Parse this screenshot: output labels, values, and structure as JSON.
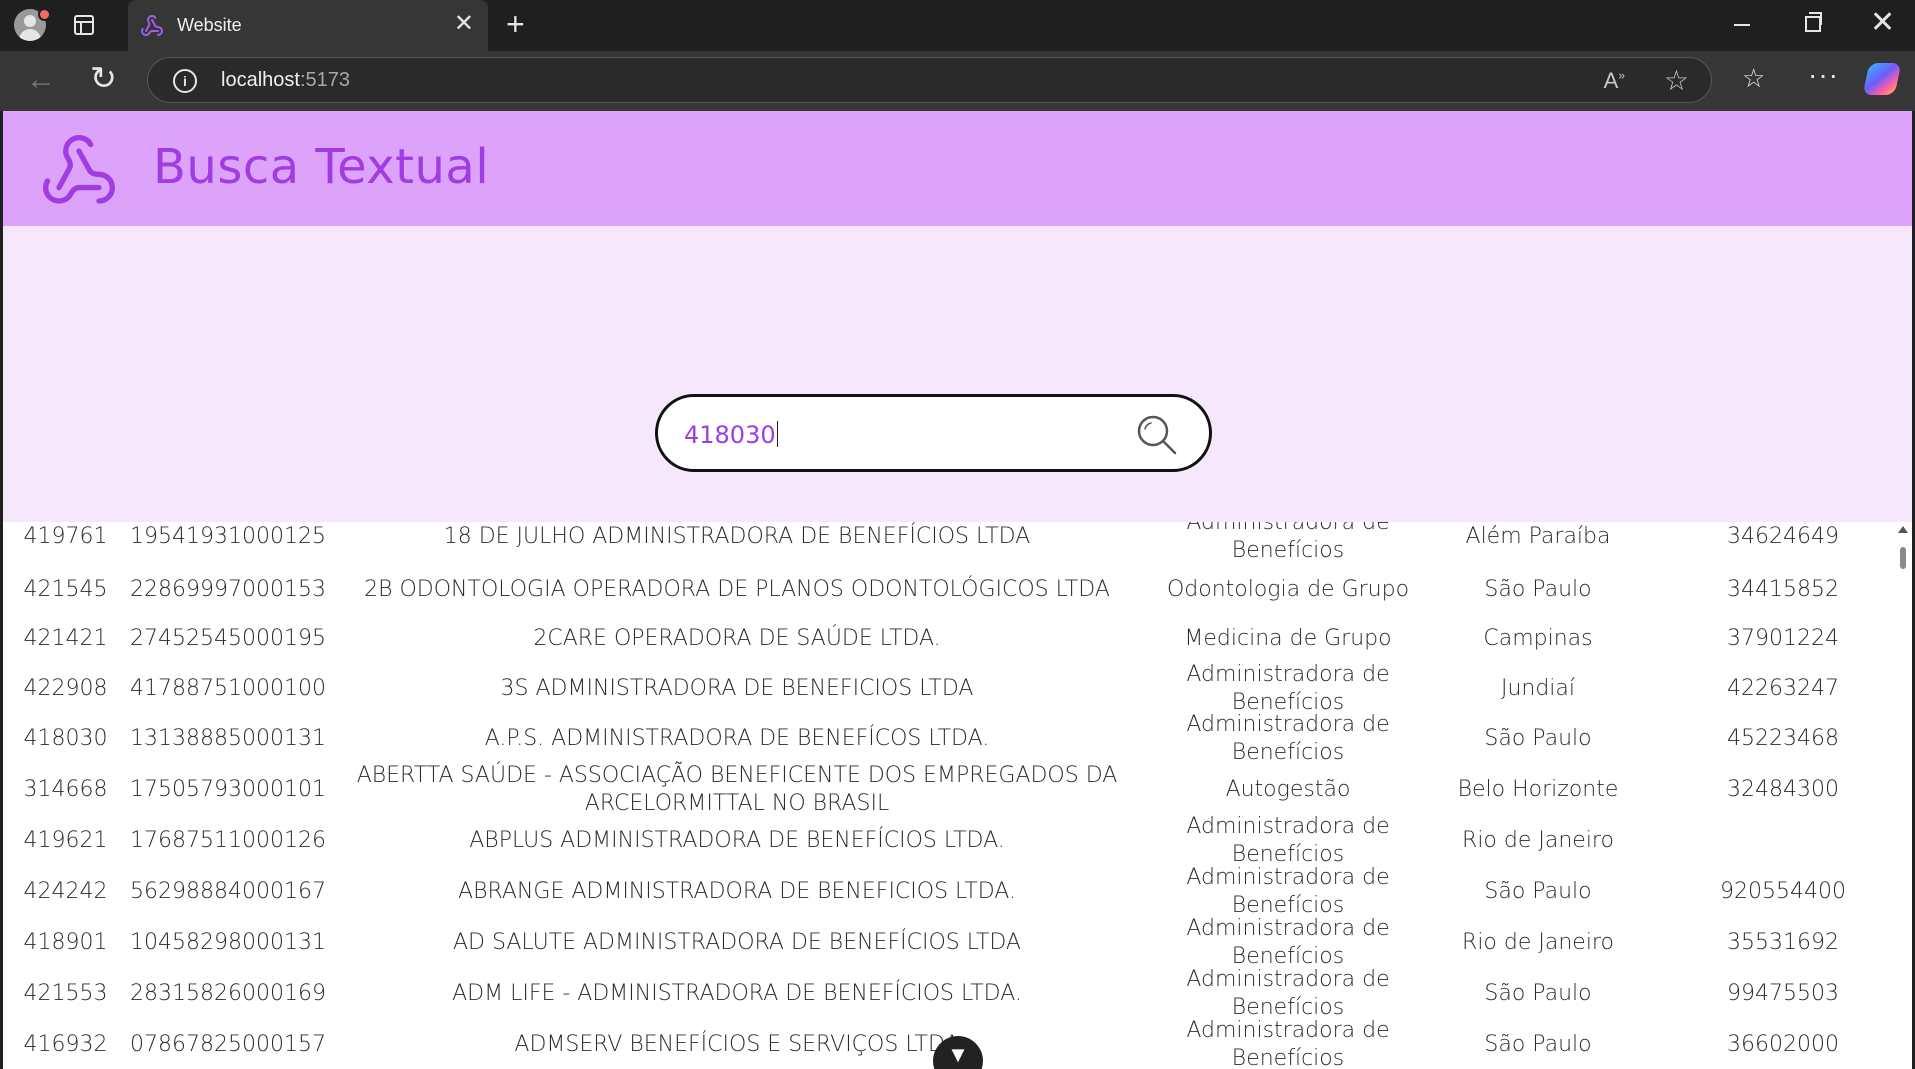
{
  "browser": {
    "tab_title": "Website",
    "url_host": "localhost",
    "url_port": ":5173"
  },
  "app": {
    "title": "Busca Textual",
    "accent_color": "#9f3de3",
    "header_color": "#dda2fa"
  },
  "search": {
    "value": "418030"
  },
  "results": [
    {
      "registro": "419761",
      "cnpj": "19541931000125",
      "nome": "18 DE JULHO ADMINISTRADORA DE BENEFÍCIOS LTDA",
      "modalidade": "Administradora de Benefícios",
      "cidade": "Além Paraíba",
      "telefone": "34624649"
    },
    {
      "registro": "421545",
      "cnpj": "22869997000153",
      "nome": "2B ODONTOLOGIA OPERADORA DE PLANOS ODONTOLÓGICOS LTDA",
      "modalidade": "Odontologia de Grupo",
      "cidade": "São Paulo",
      "telefone": "34415852"
    },
    {
      "registro": "421421",
      "cnpj": "27452545000195",
      "nome": "2CARE OPERADORA DE SAÚDE LTDA.",
      "modalidade": "Medicina de Grupo",
      "cidade": "Campinas",
      "telefone": "37901224"
    },
    {
      "registro": "422908",
      "cnpj": "41788751000100",
      "nome": "3S ADMINISTRADORA DE BENEFICIOS LTDA",
      "modalidade": "Administradora de Benefícios",
      "cidade": "Jundiaí",
      "telefone": "42263247"
    },
    {
      "registro": "418030",
      "cnpj": "13138885000131",
      "nome": "A.P.S. ADMINISTRADORA DE BENEFÍCOS LTDA.",
      "modalidade": "Administradora de Benefícios",
      "cidade": "São Paulo",
      "telefone": "45223468"
    },
    {
      "registro": "314668",
      "cnpj": "17505793000101",
      "nome": "ABERTTA SAÚDE - ASSOCIAÇÃO BENEFICENTE DOS EMPREGADOS DA ARCELORMITTAL NO BRASIL",
      "modalidade": "Autogestão",
      "cidade": "Belo Horizonte",
      "telefone": "32484300"
    },
    {
      "registro": "419621",
      "cnpj": "17687511000126",
      "nome": "ABPLUS ADMINISTRADORA DE BENEFÍCIOS LTDA.",
      "modalidade": "Administradora de Benefícios",
      "cidade": "Rio de Janeiro",
      "telefone": ""
    },
    {
      "registro": "424242",
      "cnpj": "56298884000167",
      "nome": "ABRANGE ADMINISTRADORA DE BENEFICIOS LTDA.",
      "modalidade": "Administradora de Benefícios",
      "cidade": "São Paulo",
      "telefone": "920554400"
    },
    {
      "registro": "418901",
      "cnpj": "10458298000131",
      "nome": "AD SALUTE ADMINISTRADORA DE BENEFÍCIOS LTDA",
      "modalidade": "Administradora de Benefícios",
      "cidade": "Rio de Janeiro",
      "telefone": "35531692"
    },
    {
      "registro": "421553",
      "cnpj": "28315826000169",
      "nome": "ADM LIFE - ADMINISTRADORA DE BENEFÍCIOS LTDA.",
      "modalidade": "Administradora de Benefícios",
      "cidade": "São Paulo",
      "telefone": "99475503"
    },
    {
      "registro": "416932",
      "cnpj": "07867825000157",
      "nome": "ADMSERV BENEFÍCIOS E SERVIÇOS LTDA",
      "modalidade": "Administradora de Benefícios",
      "cidade": "São Paulo",
      "telefone": "36602000"
    },
    {
      "registro": "",
      "cnpj": "",
      "nome": "",
      "modalidade": "Administradora de Benefícios",
      "cidade": "",
      "telefone": ""
    }
  ]
}
